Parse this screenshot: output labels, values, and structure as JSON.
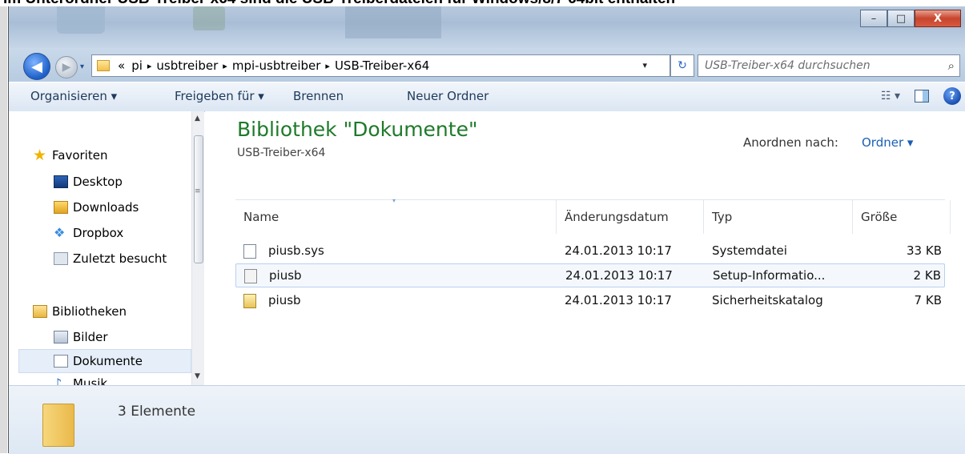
{
  "caption": "Im Unterordner USB-Treiber-x64 sind die USB-Treiberdateien für Windows/8/7 64bit enthalten",
  "window_controls": {
    "minimize": "–",
    "maximize": "□",
    "close": "X"
  },
  "nav_buttons": {
    "back": "◀",
    "forward": "▶",
    "history": "▾"
  },
  "breadcrumb": {
    "overflow": "«",
    "separator": "▸",
    "items": [
      "pi",
      "usbtreiber",
      "mpi-usbtreiber",
      "USB-Treiber-x64"
    ],
    "dropdown": "▾",
    "refresh": "↻"
  },
  "search": {
    "placeholder": "USB-Treiber-x64 durchsuchen",
    "icon": "⌕"
  },
  "toolbar": {
    "organize": "Organisieren ▾",
    "share": "Freigeben für ▾",
    "burn": "Brennen",
    "new_folder": "Neuer Ordner",
    "view_menu": "☷ ▾",
    "help": "?"
  },
  "sidebar": {
    "favorites": {
      "label": "Favoriten",
      "items": [
        "Desktop",
        "Downloads",
        "Dropbox",
        "Zuletzt besucht"
      ]
    },
    "libraries": {
      "label": "Bibliotheken",
      "items": [
        "Bilder",
        "Dokumente",
        "Musik"
      ]
    },
    "selected": "Dokumente",
    "scroll": {
      "up": "▲",
      "down": "▼",
      "grip": "≡"
    }
  },
  "main": {
    "library_title": "Bibliothek \"Dokumente\"",
    "subtitle": "USB-Treiber-x64",
    "arrange_label": "Anordnen nach:",
    "arrange_value": "Ordner ▾",
    "sort_indicator": "▾",
    "columns": [
      "Name",
      "Änderungsdatum",
      "Typ",
      "Größe"
    ],
    "files": [
      {
        "name": "piusb.sys",
        "date": "24.01.2013 10:17",
        "type": "Systemdatei",
        "size": "33 KB"
      },
      {
        "name": "piusb",
        "date": "24.01.2013 10:17",
        "type": "Setup-Informatio...",
        "size": "2 KB"
      },
      {
        "name": "piusb",
        "date": "24.01.2013 10:17",
        "type": "Sicherheitskatalog",
        "size": "7 KB"
      }
    ],
    "selected_row": 1
  },
  "status": {
    "count": "3 Elemente"
  }
}
